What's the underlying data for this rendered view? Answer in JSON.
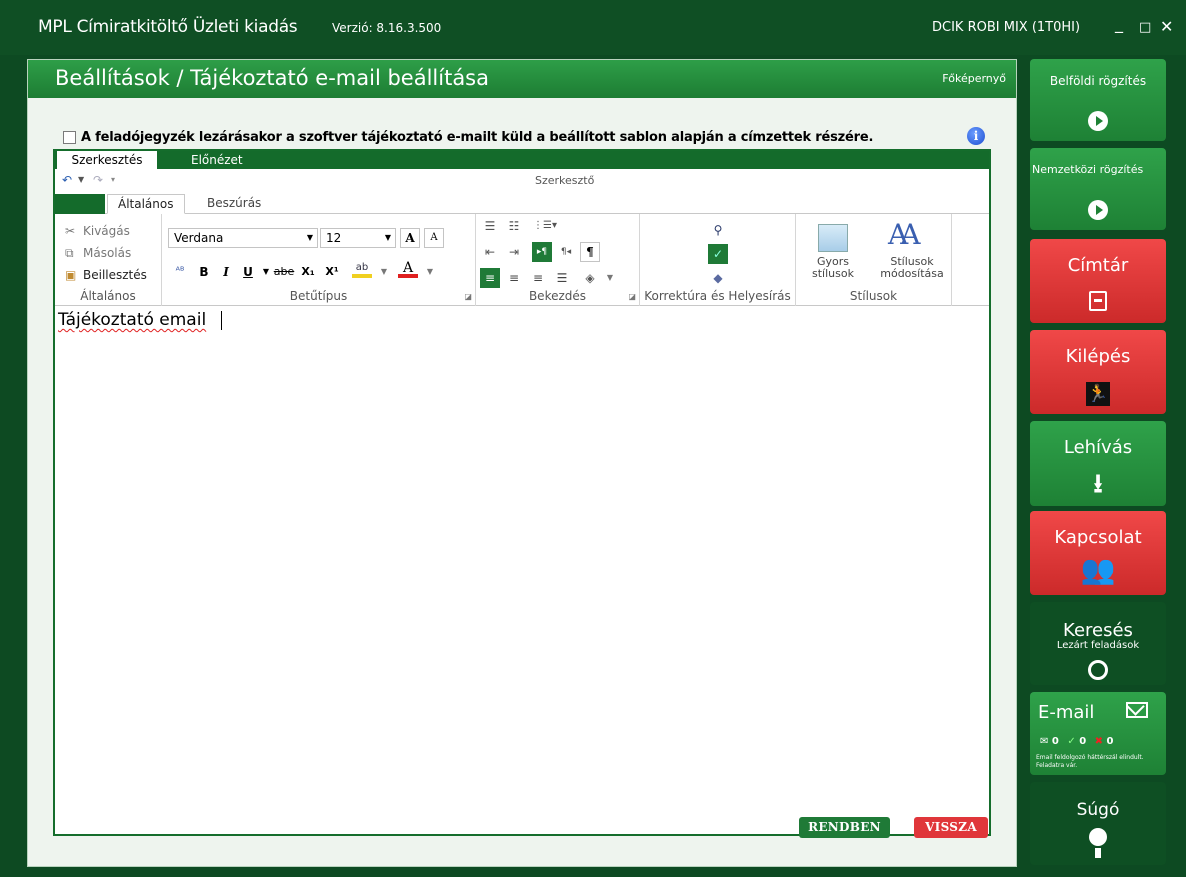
{
  "window": {
    "title": "MPL Címiratkitöltő Üzleti kiadás",
    "version": "Verzió: 8.16.3.500",
    "user": "DCIK ROBI MIX (1T0HI)"
  },
  "page": {
    "title": "Beállítások / Tájékoztató e-mail beállítása",
    "home_link": "Főképernyő",
    "notify_checkbox_label": "A feladójegyzék lezárásakor a szoftver tájékoztató e-mailt küld a beállított sablon alapján a címzettek részére.",
    "notify_checked": false
  },
  "editor": {
    "tabs": [
      "Szerkesztés",
      "Előnézet"
    ],
    "active_tab": "Szerkesztés",
    "caption": "Szerkesztő",
    "ribbon_tabs": [
      "Általános",
      "Beszúrás"
    ],
    "active_ribbon_tab": "Általános",
    "groups": {
      "general": {
        "label": "Általános",
        "cut": "Kivágás",
        "copy": "Másolás",
        "paste": "Beillesztés"
      },
      "font": {
        "label": "Betűtípus",
        "font_name": "Verdana",
        "font_size": "12",
        "bold": "B",
        "italic": "I",
        "underline": "U",
        "strike": "abe",
        "subscript": "X₁",
        "superscript": "X¹",
        "grow": "A",
        "shrink": "A",
        "font_color": "A",
        "highlight": "ab"
      },
      "paragraph": {
        "label": "Bekezdés",
        "pilcrow": "¶"
      },
      "proofing": {
        "label": "Korrektúra és Helyesírás"
      },
      "styles": {
        "label": "Stílusok",
        "quick_styles": "Gyors stílusok",
        "modify_styles": "Stílusok módosítása"
      }
    },
    "content": "Tájékoztató email"
  },
  "actions": {
    "ok": "RENDBEN",
    "back": "VISSZA"
  },
  "sidebar": {
    "domestic": "Belföldi rögzítés",
    "international": "Nemzetközi rögzítés",
    "address_book": "Címtár",
    "exit": "Kilépés",
    "retrieve": "Lehívás",
    "contact": "Kapcsolat",
    "search": "Keresés",
    "search_sub": "Lezárt feladások",
    "email": "E-mail",
    "email_counts": {
      "sent": "0",
      "ok": "0",
      "error": "0"
    },
    "email_status": "Email feldolgozó háttérszál elindult. Feladatra vár.",
    "help": "Súgó"
  },
  "colors": {
    "accent_green": "#1e8135",
    "dark_green": "#0e4f23",
    "red": "#e0363a"
  }
}
